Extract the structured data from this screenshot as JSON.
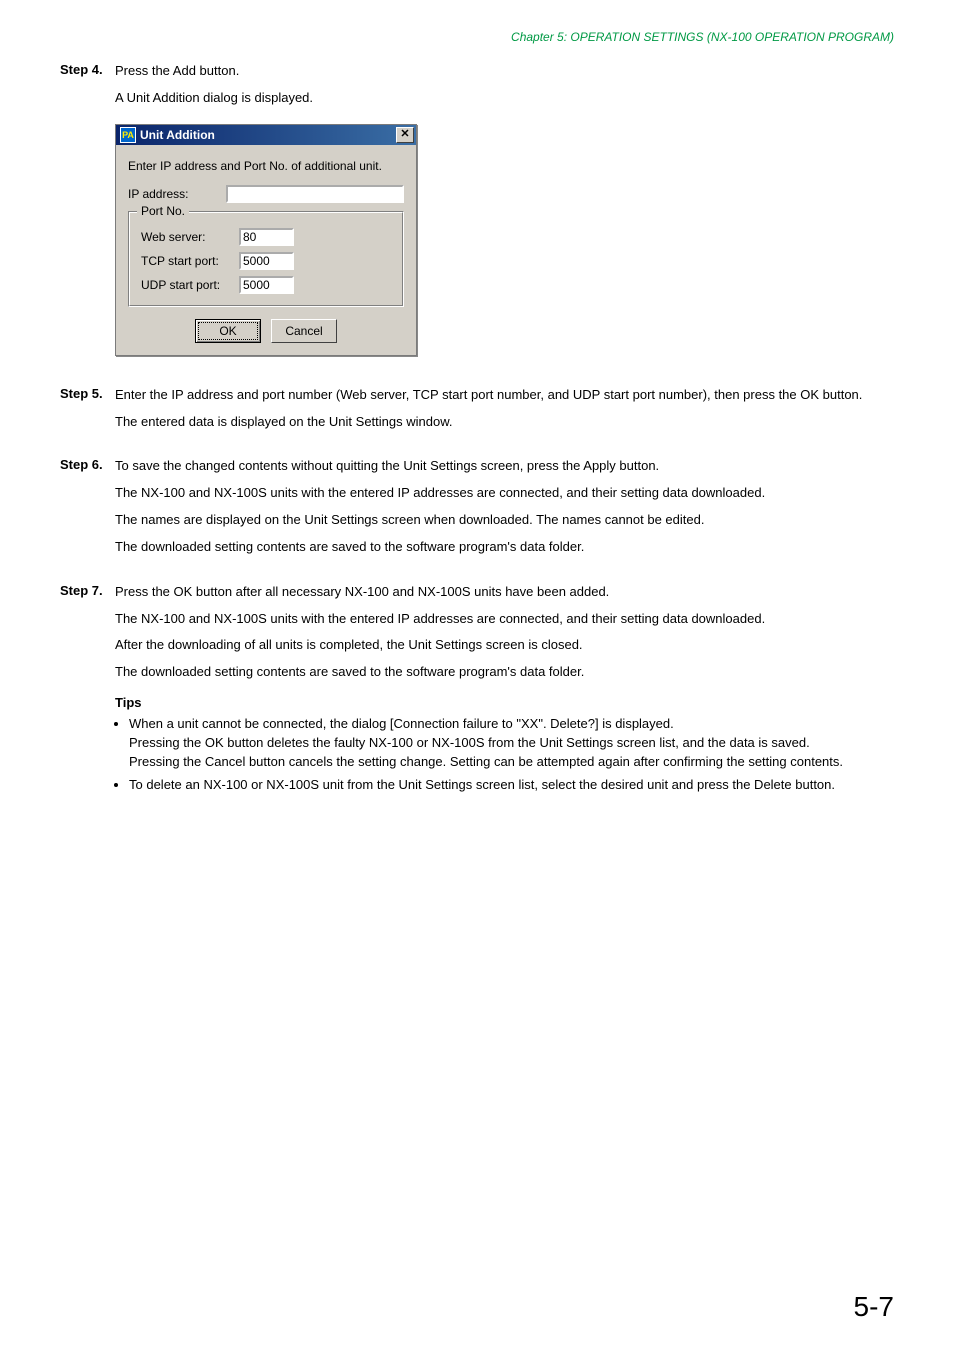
{
  "header": {
    "text": "Chapter 5:  OPERATION SETTINGS (NX-100 OPERATION PROGRAM)"
  },
  "steps": {
    "step4": {
      "label": "Step 4.",
      "line1": "Press the Add button.",
      "line2": "A Unit Addition dialog is displayed."
    },
    "step5": {
      "label": "Step 5.",
      "line1": "Enter the IP address and port number (Web server, TCP start port number, and UDP start port number), then press the OK button.",
      "line2": "The entered data is displayed on the Unit Settings window."
    },
    "step6": {
      "label": "Step 6.",
      "line1": "To save the changed contents without quitting the Unit Settings screen, press the Apply button.",
      "line2": "The NX-100 and NX-100S units with the entered IP addresses are connected, and their setting data downloaded.",
      "line3": "The names are displayed on the Unit Settings screen when downloaded. The names cannot be edited.",
      "line4": "The downloaded setting contents are saved to the software program's data folder."
    },
    "step7": {
      "label": "Step 7.",
      "line1": "Press the OK button after all necessary NX-100 and NX-100S units have been added.",
      "line2": "The NX-100 and NX-100S units with the entered IP addresses are connected, and their setting data downloaded.",
      "line3": "After the downloading of all units is completed, the Unit Settings screen is closed.",
      "line4": "The downloaded setting contents are saved to the software program's data folder."
    }
  },
  "dialog": {
    "title": "Unit Addition",
    "icon_text": "PA",
    "close_glyph": "✕",
    "message": "Enter IP address and Port No. of additional unit.",
    "ip_label": "IP address:",
    "ip_value": "",
    "group_label": "Port No.",
    "web_label": "Web server:",
    "web_value": "80",
    "tcp_label": "TCP start port:",
    "tcp_value": "5000",
    "udp_label": "UDP start port:",
    "udp_value": "5000",
    "ok_label": "OK",
    "cancel_label": "Cancel"
  },
  "tips": {
    "heading": "Tips",
    "item1_a": "When a unit cannot be connected, the dialog [Connection failure to \"XX\". Delete?] is displayed.",
    "item1_b": "Pressing the OK button deletes the faulty NX-100 or NX-100S from the Unit Settings screen list, and the data is saved.",
    "item1_c": "Pressing the Cancel button cancels the setting change. Setting can be attempted again after confirming the setting contents.",
    "item2": "To delete an NX-100 or NX-100S unit from the Unit Settings screen list, select the desired unit and press the Delete button."
  },
  "page_number": "5-7"
}
